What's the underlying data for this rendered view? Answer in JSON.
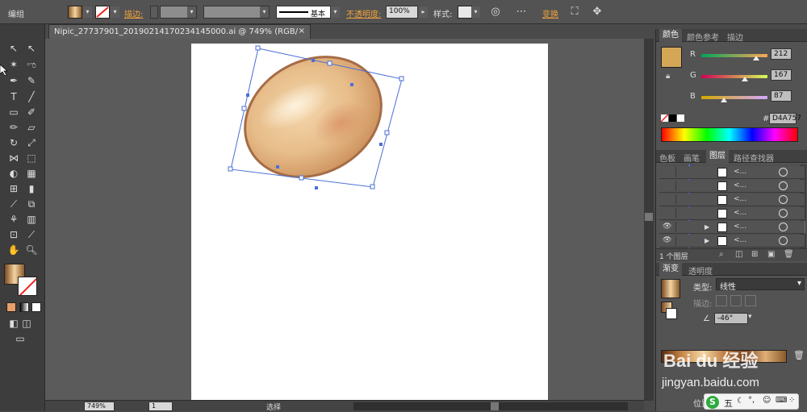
{
  "topbar": {
    "mode_label": "编组",
    "stroke_label": "描边:",
    "brush_label": "基本",
    "opacity_label": "不透明度:",
    "opacity_value": "100%",
    "style_label": "样式:",
    "transform_label": "变换"
  },
  "document": {
    "tab_title": "Nipic_27737901_20190214170234145000.ai @ 749% (RGB/预览)",
    "close_glyph": "×"
  },
  "statusbar": {
    "zoom": "749%",
    "page": "1",
    "mode": "选择"
  },
  "color_panel": {
    "tabs": [
      "颜色",
      "颜色参考",
      "描边"
    ],
    "r_label": "R",
    "g_label": "G",
    "b_label": "B",
    "r_value": "212",
    "g_value": "167",
    "b_value": "87",
    "r_fraction": 0.831,
    "g_fraction": 0.655,
    "b_fraction": 0.341,
    "hash": "#",
    "hex_value": "D4A757",
    "swatch_color": "#D4A757"
  },
  "layers_panel": {
    "tabs": [
      "色板",
      "画笔",
      "图层",
      "路径查找器"
    ],
    "rows": [
      {
        "name": "<...",
        "visible": false,
        "expand": ""
      },
      {
        "name": "<...",
        "visible": false,
        "expand": ""
      },
      {
        "name": "<...",
        "visible": false,
        "expand": ""
      },
      {
        "name": "<...",
        "visible": false,
        "expand": ""
      },
      {
        "name": "<...",
        "visible": true,
        "expand": "▶"
      },
      {
        "name": "<...",
        "visible": true,
        "expand": "▶"
      }
    ],
    "footer": "1 个图层"
  },
  "gradient_panel": {
    "tabs": [
      "渐变",
      "透明度"
    ],
    "type_label": "类型:",
    "type_value": "线性",
    "stroke_label": "描边:",
    "angle_value": "-46°",
    "position_label": "位置"
  },
  "watermark": {
    "brand": "Bai du 经验",
    "url": "jingyan.baidu.com"
  },
  "colors": {
    "accent_orange": "#f2a23a",
    "selection_blue": "#4a6fd6"
  }
}
